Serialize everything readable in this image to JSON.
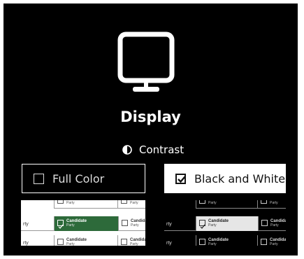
{
  "display": {
    "title": "Display",
    "contrast_label": "Contrast",
    "icons": {
      "monitor": "monitor-icon",
      "contrast": "contrast-icon",
      "check": "check-icon"
    }
  },
  "options": {
    "full_color": {
      "label": "Full Color",
      "checked": false
    },
    "black_white": {
      "label": "Black and White",
      "checked": true
    }
  },
  "preview": {
    "party_stub": "rty",
    "candidate": "Candidate",
    "party": "Party"
  },
  "colors": {
    "background": "#000000",
    "selected_green": "#2d6a3a",
    "selected_gray": "#e6e6e6"
  }
}
